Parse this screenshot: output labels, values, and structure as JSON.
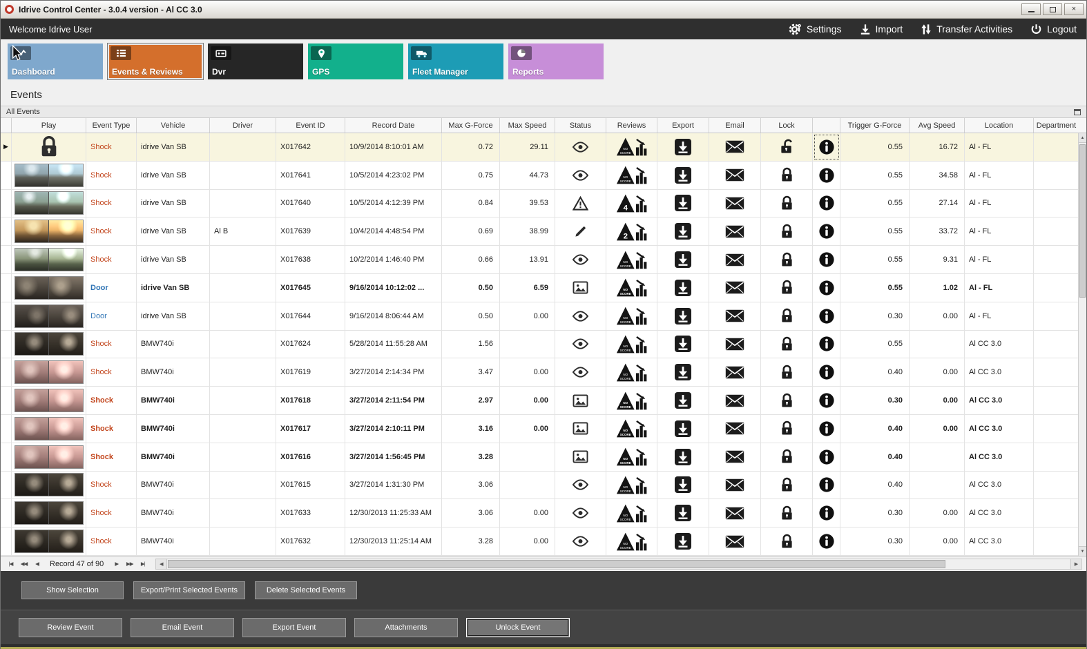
{
  "window": {
    "title": "Idrive Control Center - 3.0.4 version - Al CC 3.0",
    "controls": {
      "minimize": "–",
      "maximize": "",
      "close": "×"
    }
  },
  "topbar": {
    "welcome": "Welcome Idrive User",
    "actions": [
      {
        "label": "Settings",
        "icon": "gear-icon"
      },
      {
        "label": "Import",
        "icon": "import-icon"
      },
      {
        "label": "Transfer Activities",
        "icon": "transfer-icon"
      },
      {
        "label": "Logout",
        "icon": "power-icon"
      }
    ]
  },
  "nav_tiles": [
    {
      "label": "Dashboard",
      "color": "#7fa8cd",
      "icon": "line-chart-icon",
      "active": false
    },
    {
      "label": "Events & Reviews",
      "color": "#d46f2c",
      "icon": "list-icon",
      "active": true
    },
    {
      "label": "Dvr",
      "color": "#262626",
      "icon": "dvr-icon",
      "active": false
    },
    {
      "label": "GPS",
      "color": "#12b08c",
      "icon": "map-pin-icon",
      "active": false
    },
    {
      "label": "Fleet Manager",
      "color": "#1d9cb5",
      "icon": "truck-icon",
      "active": false
    },
    {
      "label": "Reports",
      "color": "#c78ed8",
      "icon": "pie-chart-icon",
      "active": false
    }
  ],
  "page": {
    "heading": "Events",
    "group_label": "All Events"
  },
  "table": {
    "columns": [
      "",
      "Play",
      "Event Type",
      "Vehicle",
      "Driver",
      "Event ID",
      "Record Date",
      "Max G-Force",
      "Max Speed",
      "Status",
      "Reviews",
      "Export",
      "Email",
      "Lock",
      "",
      "Trigger G-Force",
      "Avg Speed",
      "Location",
      "Department"
    ],
    "event_type_colors": {
      "Shock": "#c2451c",
      "Door": "#2f74b5"
    },
    "rows": [
      {
        "thumb": "lock",
        "event_type": "Shock",
        "vehicle": "idrive Van SB",
        "driver": "",
        "event_id": "X017642",
        "record_date": "10/9/2014 8:10:01 AM",
        "max_g": "0.72",
        "max_speed": "29.11",
        "status": "eye",
        "review": "NO SCORE",
        "lock": "unlocked",
        "trigger_g": "0.55",
        "avg_speed": "16.72",
        "location": "Al - FL",
        "selected": true,
        "bold": false,
        "info_focused": true
      },
      {
        "thumb": "road-day",
        "event_type": "Shock",
        "vehicle": "idrive Van SB",
        "driver": "",
        "event_id": "X017641",
        "record_date": "10/5/2014 4:23:02 PM",
        "max_g": "0.75",
        "max_speed": "44.73",
        "status": "eye",
        "review": "NO SCORE",
        "lock": "locked",
        "trigger_g": "0.55",
        "avg_speed": "34.58",
        "location": "Al - FL"
      },
      {
        "thumb": "road-day2",
        "event_type": "Shock",
        "vehicle": "idrive Van SB",
        "driver": "",
        "event_id": "X017640",
        "record_date": "10/5/2014 4:12:39 PM",
        "max_g": "0.84",
        "max_speed": "39.53",
        "status": "warning",
        "review": "4",
        "lock": "locked",
        "trigger_g": "0.55",
        "avg_speed": "27.14",
        "location": "Al - FL"
      },
      {
        "thumb": "road-sunset",
        "event_type": "Shock",
        "vehicle": "idrive Van SB",
        "driver": "Al B",
        "event_id": "X017639",
        "record_date": "10/4/2014 4:48:54 PM",
        "max_g": "0.69",
        "max_speed": "38.99",
        "status": "pencil",
        "review": "2",
        "lock": "locked",
        "trigger_g": "0.55",
        "avg_speed": "33.72",
        "location": "Al - FL"
      },
      {
        "thumb": "road-trees",
        "event_type": "Shock",
        "vehicle": "idrive Van SB",
        "driver": "",
        "event_id": "X017638",
        "record_date": "10/2/2014 1:46:40 PM",
        "max_g": "0.66",
        "max_speed": "13.91",
        "status": "eye",
        "review": "NO SCORE",
        "lock": "locked",
        "trigger_g": "0.55",
        "avg_speed": "9.31",
        "location": "Al - FL"
      },
      {
        "thumb": "garage",
        "event_type": "Door",
        "vehicle": "idrive Van SB",
        "driver": "",
        "event_id": "X017645",
        "record_date": "9/16/2014 10:12:02 ...",
        "max_g": "0.50",
        "max_speed": "6.59",
        "status": "image",
        "review": "NO SCORE",
        "lock": "locked",
        "trigger_g": "0.55",
        "avg_speed": "1.02",
        "location": "Al - FL",
        "bold": true
      },
      {
        "thumb": "garage2",
        "event_type": "Door",
        "vehicle": "idrive Van SB",
        "driver": "",
        "event_id": "X017644",
        "record_date": "9/16/2014 8:06:44 AM",
        "max_g": "0.50",
        "max_speed": "0.00",
        "status": "eye",
        "review": "NO SCORE",
        "lock": "locked",
        "trigger_g": "0.30",
        "avg_speed": "0.00",
        "location": "Al - FL"
      },
      {
        "thumb": "interior-dark",
        "event_type": "Shock",
        "vehicle": "BMW740i",
        "driver": "",
        "event_id": "X017624",
        "record_date": "5/28/2014 11:55:28 AM",
        "max_g": "1.56",
        "max_speed": "",
        "status": "eye",
        "review": "NO SCORE",
        "lock": "locked",
        "trigger_g": "0.55",
        "avg_speed": "",
        "location": "Al CC 3.0"
      },
      {
        "thumb": "interior-pink",
        "event_type": "Shock",
        "vehicle": "BMW740i",
        "driver": "",
        "event_id": "X017619",
        "record_date": "3/27/2014 2:14:34 PM",
        "max_g": "3.47",
        "max_speed": "0.00",
        "status": "eye",
        "review": "NO SCORE",
        "lock": "locked",
        "trigger_g": "0.40",
        "avg_speed": "0.00",
        "location": "Al CC 3.0"
      },
      {
        "thumb": "interior-pink",
        "event_type": "Shock",
        "vehicle": "BMW740i",
        "driver": "",
        "event_id": "X017618",
        "record_date": "3/27/2014 2:11:54 PM",
        "max_g": "2.97",
        "max_speed": "0.00",
        "status": "image",
        "review": "NO SCORE",
        "lock": "locked",
        "trigger_g": "0.30",
        "avg_speed": "0.00",
        "location": "Al CC 3.0",
        "bold": true
      },
      {
        "thumb": "interior-pink",
        "event_type": "Shock",
        "vehicle": "BMW740i",
        "driver": "",
        "event_id": "X017617",
        "record_date": "3/27/2014 2:10:11 PM",
        "max_g": "3.16",
        "max_speed": "0.00",
        "status": "image",
        "review": "NO SCORE",
        "lock": "locked",
        "trigger_g": "0.40",
        "avg_speed": "0.00",
        "location": "Al CC 3.0",
        "bold": true
      },
      {
        "thumb": "interior-pink",
        "event_type": "Shock",
        "vehicle": "BMW740i",
        "driver": "",
        "event_id": "X017616",
        "record_date": "3/27/2014 1:56:45 PM",
        "max_g": "3.28",
        "max_speed": "",
        "status": "image",
        "review": "NO SCORE",
        "lock": "locked",
        "trigger_g": "0.40",
        "avg_speed": "",
        "location": "Al CC 3.0",
        "bold": true
      },
      {
        "thumb": "interior-dark",
        "event_type": "Shock",
        "vehicle": "BMW740i",
        "driver": "",
        "event_id": "X017615",
        "record_date": "3/27/2014 1:31:30 PM",
        "max_g": "3.06",
        "max_speed": "",
        "status": "eye",
        "review": "NO SCORE",
        "lock": "locked",
        "trigger_g": "0.40",
        "avg_speed": "",
        "location": "Al CC 3.0"
      },
      {
        "thumb": "interior-dark",
        "event_type": "Shock",
        "vehicle": "BMW740i",
        "driver": "",
        "event_id": "X017633",
        "record_date": "12/30/2013 11:25:33 AM",
        "max_g": "3.06",
        "max_speed": "0.00",
        "status": "eye",
        "review": "NO SCORE",
        "lock": "locked",
        "trigger_g": "0.30",
        "avg_speed": "0.00",
        "location": "Al CC 3.0"
      },
      {
        "thumb": "interior-dark",
        "event_type": "Shock",
        "vehicle": "BMW740i",
        "driver": "",
        "event_id": "X017632",
        "record_date": "12/30/2013 11:25:14 AM",
        "max_g": "3.28",
        "max_speed": "0.00",
        "status": "eye",
        "review": "NO SCORE",
        "lock": "locked",
        "trigger_g": "0.30",
        "avg_speed": "0.00",
        "location": "Al CC 3.0"
      }
    ]
  },
  "pagination": {
    "record_label": "Record 47 of 90",
    "nav": [
      {
        "name": "first-record",
        "glyph": "|◀"
      },
      {
        "name": "prev-page",
        "glyph": "◀◀"
      },
      {
        "name": "prev-record",
        "glyph": "◀"
      },
      {
        "name": "next-record",
        "glyph": "▶"
      },
      {
        "name": "next-page",
        "glyph": "▶▶"
      },
      {
        "name": "last-record",
        "glyph": "▶|"
      }
    ]
  },
  "selection_actions": [
    "Show Selection",
    "Export/Print Selected Events",
    "Delete Selected  Events"
  ],
  "event_actions": [
    "Review Event",
    "Email Event",
    "Export Event",
    "Attachments",
    "Unlock Event"
  ],
  "focused_action": "Unlock Event"
}
